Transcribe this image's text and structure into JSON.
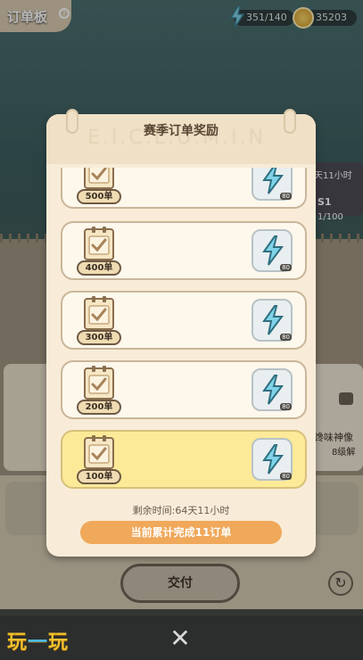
{
  "hud": {
    "screen_title": "订单板",
    "energy": "351/140",
    "coins": "35203"
  },
  "background": {
    "peek_time": "天11小时",
    "peek_level": "S1",
    "peek_progress": "1/100",
    "peek_item_name": "馋味神像",
    "peek_item_unlock": "8级解",
    "deliver_label": "交付"
  },
  "modal": {
    "title": "赛季订单奖励",
    "decor_text": "E.I.C.L.U.M.I.N",
    "rows": [
      {
        "badge": "500单",
        "reward_qty": "80",
        "completed": false
      },
      {
        "badge": "400单",
        "reward_qty": "80",
        "completed": false
      },
      {
        "badge": "300单",
        "reward_qty": "80",
        "completed": false
      },
      {
        "badge": "200单",
        "reward_qty": "80",
        "completed": false
      },
      {
        "badge": "100单",
        "reward_qty": "80",
        "completed": true
      }
    ],
    "remaining_time": "剩余时间:64天11小时",
    "progress_label": "当前累计完成11订单"
  },
  "footer": {
    "brand_left": "玩",
    "brand_mid": "一",
    "brand_right": "玩"
  },
  "colors": {
    "accent_orange": "#f0a85a",
    "completed_row": "#fcea98",
    "modal_bg": "#f8ecd8"
  }
}
